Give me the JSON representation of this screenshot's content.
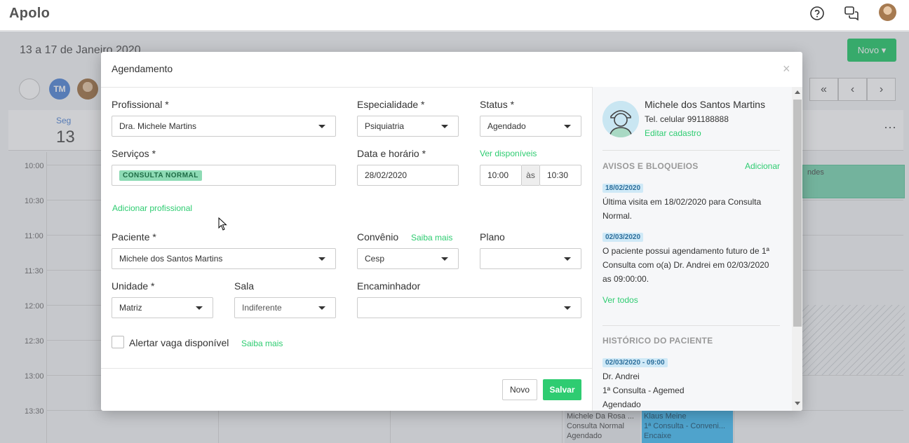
{
  "app": {
    "title": "Apolo"
  },
  "topbar": {
    "help_icon": "help-circle-icon",
    "chat_icon": "chat-bubbles-icon",
    "user_avatar": "user-avatar"
  },
  "background": {
    "week_title": "13 a 17 de Janeiro 2020",
    "novo_label": "Novo ▾",
    "tm_label": "TM",
    "day_name": "Seg",
    "day_number": "13",
    "times": [
      "10:00",
      "10:30",
      "11:00",
      "11:30",
      "12:00",
      "12:30",
      "13:00",
      "13:30"
    ],
    "event_green": "ndes",
    "event_a": [
      "Michele Da Rosa ...",
      "Consulta Normal",
      "Agendado"
    ],
    "event_b": [
      "Klaus Meine",
      "1ª Consulta - Conveni...",
      "Encaixe"
    ],
    "colors": {
      "accent": "#2ecc71",
      "blue": "#5b8dd9"
    }
  },
  "modal": {
    "title": "Agendamento",
    "close": "×",
    "profissional": {
      "label": "Profissional *",
      "value": "Dra. Michele Martins"
    },
    "especialidade": {
      "label": "Especialidade *",
      "value": "Psiquiatria"
    },
    "status": {
      "label": "Status *",
      "value": "Agendado"
    },
    "servicos": {
      "label": "Serviços *",
      "tag": "CONSULTA NORMAL"
    },
    "data_horario": {
      "label": "Data e horário *",
      "date": "28/02/2020",
      "start": "10:00",
      "sep": "às",
      "end": "10:30"
    },
    "ver_disponiveis": "Ver disponíveis",
    "adicionar_profissional": "Adicionar profissional",
    "paciente": {
      "label": "Paciente *",
      "value": "Michele dos Santos Martins"
    },
    "convenio": {
      "label": "Convênio",
      "saiba_mais": "Saiba mais",
      "value": "Cesp"
    },
    "plano": {
      "label": "Plano",
      "value": ""
    },
    "unidade": {
      "label": "Unidade *",
      "value": "Matriz"
    },
    "sala": {
      "label": "Sala",
      "value": "Indiferente"
    },
    "encaminhador": {
      "label": "Encaminhador",
      "value": ""
    },
    "alertar": {
      "label": "Alertar vaga disponível",
      "saiba_mais": "Saiba mais",
      "checked": false
    },
    "btn_novo": "Novo",
    "btn_salvar": "Salvar"
  },
  "patient_panel": {
    "name": "Michele dos Santos Martins",
    "tel": "Tel. celular 991188888",
    "edit": "Editar cadastro",
    "avisos_head": "AVISOS E BLOQUEIOS",
    "avisos_add": "Adicionar",
    "aviso1_date": "18/02/2020",
    "aviso1_text": "Última visita em 18/02/2020 para Consulta Normal.",
    "aviso2_date": "02/03/2020",
    "aviso2_text": "O paciente possui agendamento futuro de 1ª Consulta com o(a) Dr. Andrei em 02/03/2020 as 09:00:00.",
    "ver_todos": "Ver todos",
    "historico_head": "HISTÓRICO DO PACIENTE",
    "hist_date": "02/03/2020 - 09:00",
    "hist_doctor": "Dr. Andrei",
    "hist_service": "1ª Consulta - Agemed",
    "hist_status": "Agendado"
  }
}
